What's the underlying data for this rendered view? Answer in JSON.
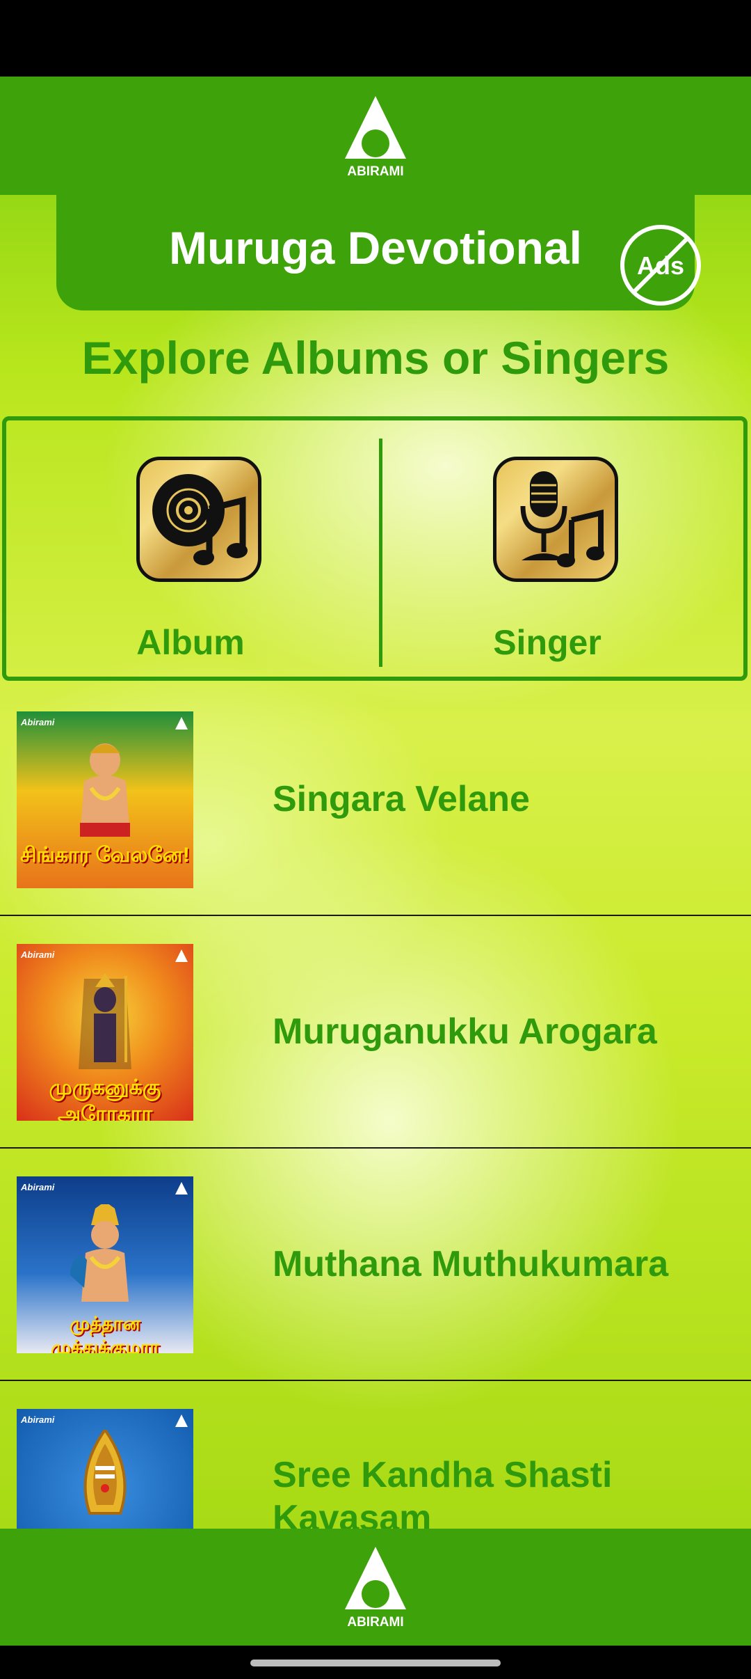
{
  "header": {
    "logo_text": "ABIRAMI",
    "title": "Muruga Devotional",
    "no_ads_label": "Ads"
  },
  "explore": {
    "heading": "Explore Albums or Singers",
    "album_label": "Album",
    "singer_label": "Singer"
  },
  "albums": [
    {
      "title": "Singara Velane",
      "cover_brand": "Abirami",
      "cover_text": "சிங்கார வேலனே!",
      "cover_colors": [
        "#1f8f3a",
        "#f2c21a",
        "#e8731a"
      ]
    },
    {
      "title": "Muruganukku Arogara",
      "cover_brand": "Abirami",
      "cover_text": "முருகனுக்கு அரோகரா",
      "cover_colors": [
        "#f7d43a",
        "#f08a1c",
        "#d9301a"
      ]
    },
    {
      "title": "Muthana Muthukumara",
      "cover_brand": "Abirami",
      "cover_text": "முத்தான முத்துக்குமரா",
      "cover_colors": [
        "#0d3d8a",
        "#2a73c9",
        "#e9e9f2"
      ]
    },
    {
      "title": "Sree Kandha Shasti Kavasam",
      "cover_brand": "Abirami",
      "cover_text": "",
      "cover_colors": [
        "#0e56a8",
        "#3a8ee0",
        "#2b6fbf"
      ]
    }
  ],
  "footer": {
    "logo_text": "ABIRAMI"
  },
  "colors": {
    "primary_green": "#3ea20a",
    "text_green": "#2f9a0c",
    "icon_gold": "#e7c45a"
  }
}
